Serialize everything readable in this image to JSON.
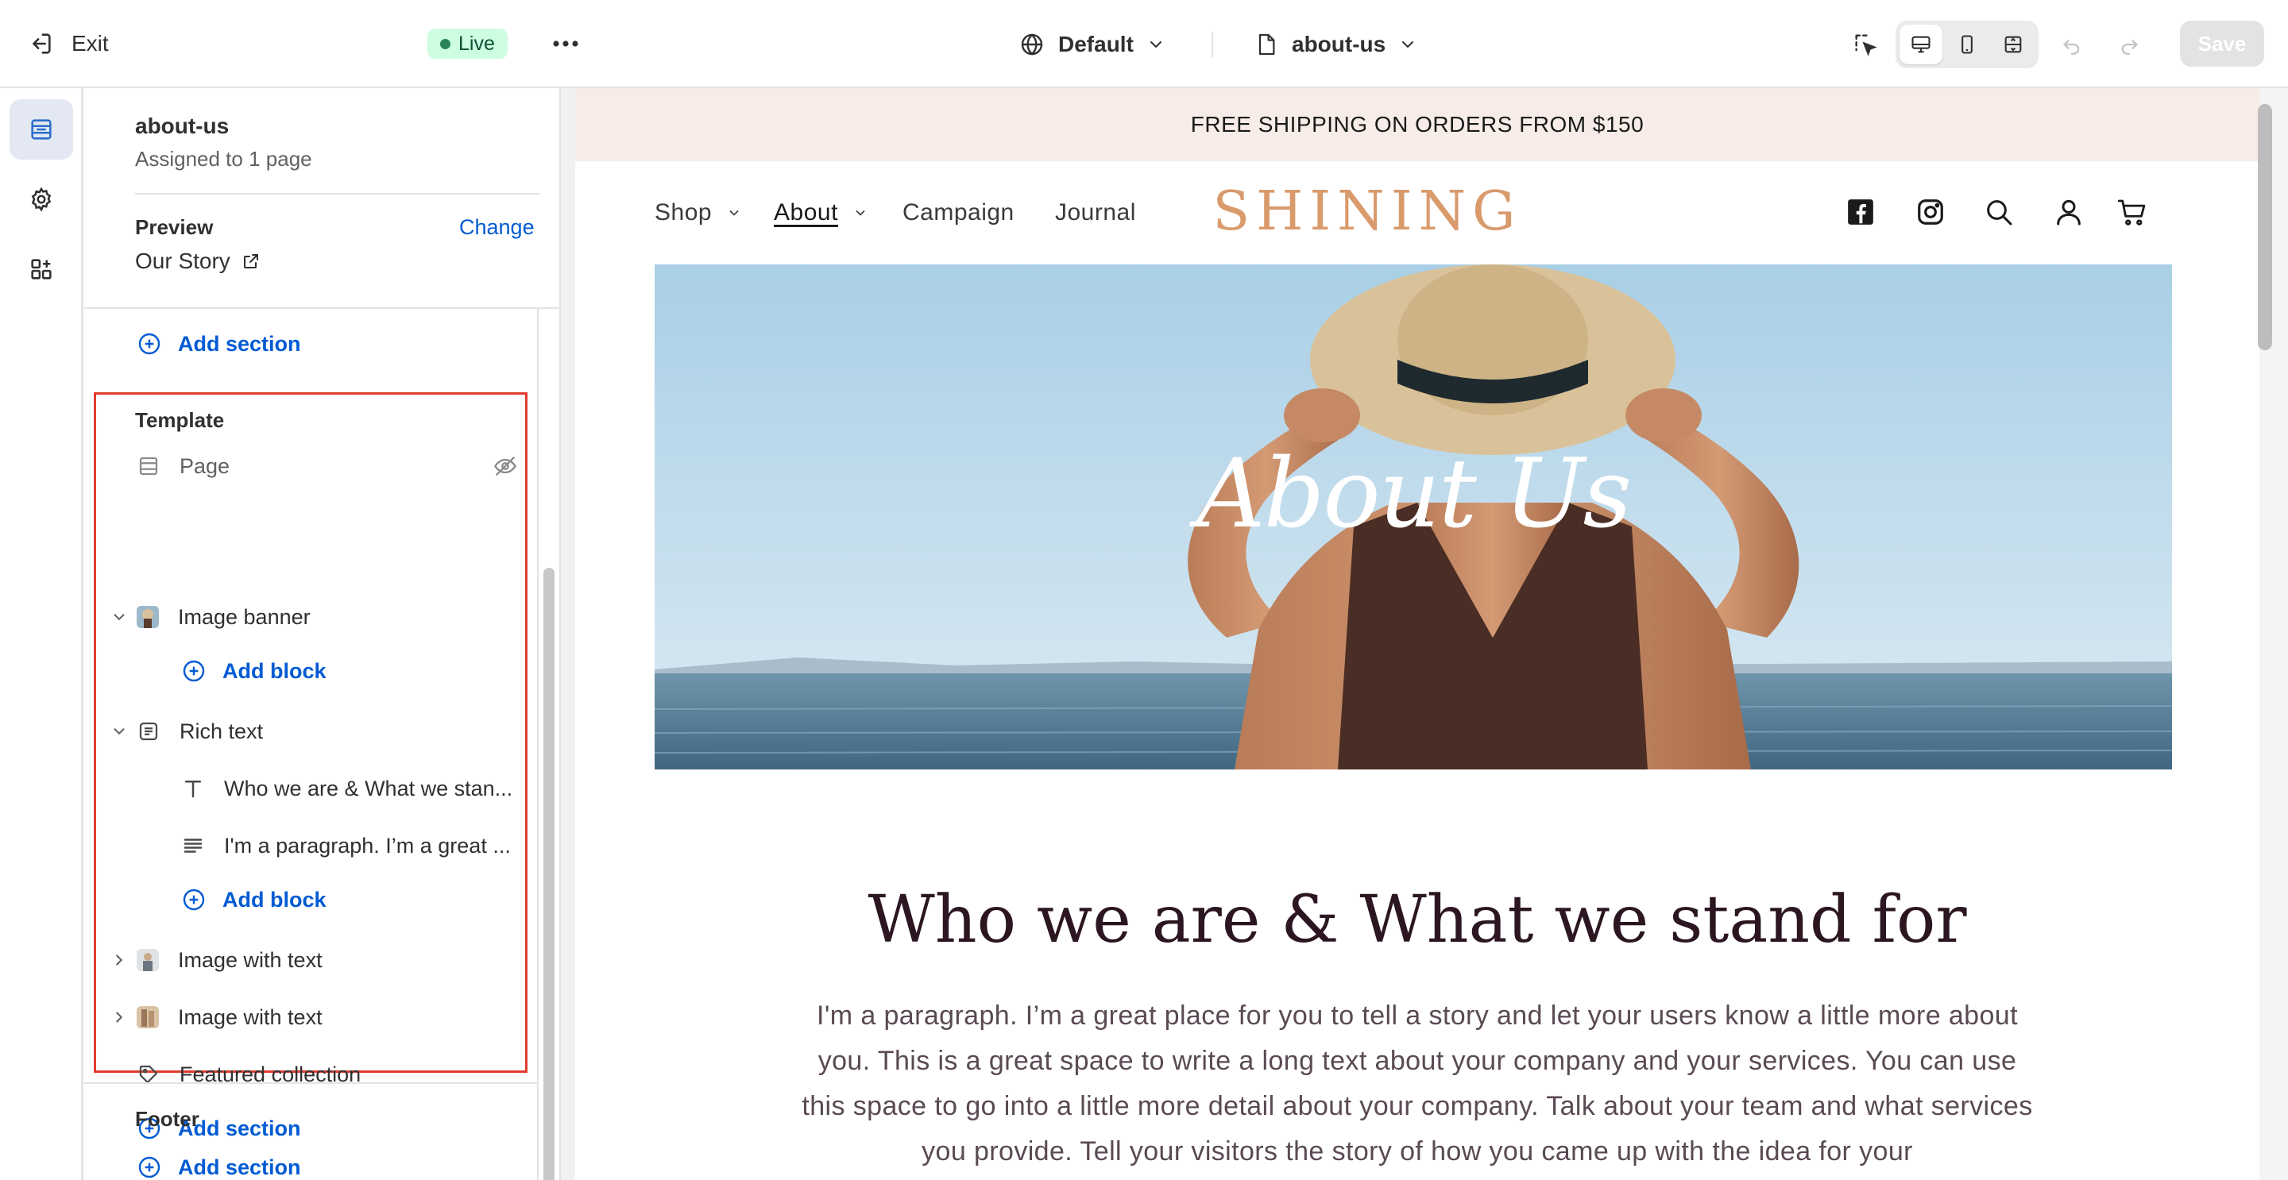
{
  "topbar": {
    "exit_label": "Exit",
    "status_badge": "Live",
    "theme_select": "Default",
    "page_select": "about-us",
    "save_label": "Save"
  },
  "rail": {
    "items": [
      {
        "icon": "sections-icon",
        "active": true
      },
      {
        "icon": "gear-icon",
        "active": false
      },
      {
        "icon": "apps-icon",
        "active": false
      }
    ]
  },
  "sidebar": {
    "template_name": "about-us",
    "assigned_text": "Assigned to 1 page",
    "preview_label": "Preview",
    "change_label": "Change",
    "preview_page": "Our Story",
    "add_section_label": "Add section",
    "template_header": "Template",
    "sections": {
      "page": "Page",
      "image_banner": "Image banner",
      "add_block": "Add block",
      "rich_text": "Rich text",
      "rich_heading_block": "Who we are & What we stan...",
      "rich_paragraph_block": "I'm a paragraph. I’m a great ...",
      "image_with_text_1": "Image with text",
      "image_with_text_2": "Image with text",
      "featured_collection": "Featured collection"
    },
    "footer_header": "Footer"
  },
  "store": {
    "announcement": "FREE SHIPPING ON ORDERS FROM $150",
    "nav": {
      "shop": "Shop",
      "about": "About",
      "campaign": "Campaign",
      "journal": "Journal"
    },
    "logo": "SHINING",
    "banner_title": "About Us",
    "heading": "Who we are & What we stand for",
    "paragraph": "I'm a paragraph. I’m a great place for you to tell a story and let your users know a little more about you. This is a great space to write a long text about your company and your services. You can use this space to go into a little more detail about your company. Talk about your team and what services you provide. Tell your visitors the story of how you came up with the idea for your"
  },
  "colors": {
    "accent_link": "#005bd3",
    "live_badge_bg": "#cdfee1",
    "highlight_border": "#e03c2e",
    "announcement_bg": "#f7ece7",
    "logo": "#d99a6c",
    "heading": "#2b1622"
  }
}
